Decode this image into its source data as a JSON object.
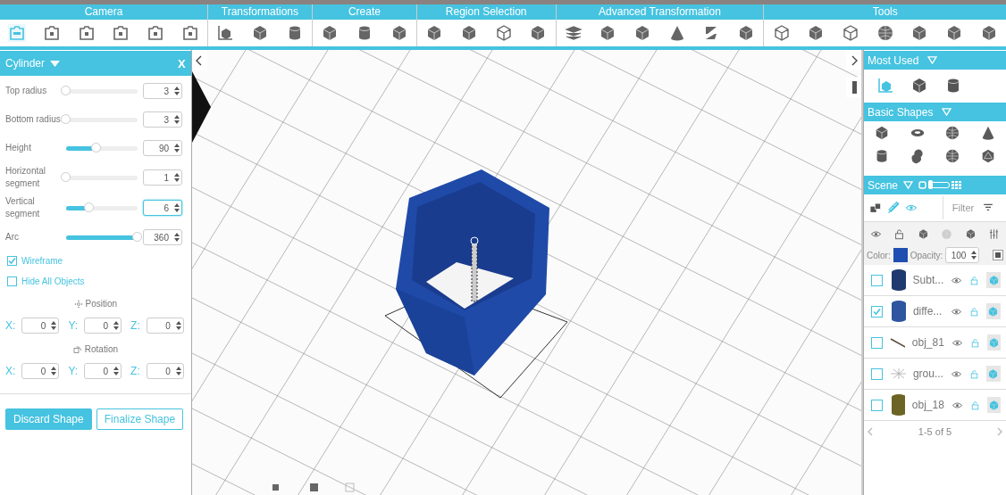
{
  "toolbar": [
    {
      "label": "Camera",
      "tools": [
        {
          "kind": "camera360",
          "selected": true
        },
        {
          "kind": "camera",
          "selected": false
        },
        {
          "kind": "camera",
          "selected": false
        },
        {
          "kind": "camera",
          "selected": false
        },
        {
          "kind": "camera",
          "selected": false
        },
        {
          "kind": "camera",
          "selected": false
        }
      ]
    },
    {
      "label": "Transformations",
      "tools": [
        {
          "kind": "axes",
          "selected": false
        },
        {
          "kind": "cube",
          "selected": false
        },
        {
          "kind": "cylinder",
          "selected": false
        }
      ]
    },
    {
      "label": "Create",
      "tools": [
        {
          "kind": "cube",
          "selected": false
        },
        {
          "kind": "cylinder",
          "selected": false
        },
        {
          "kind": "cube",
          "selected": false
        }
      ]
    },
    {
      "label": "Region Selection",
      "tools": [
        {
          "kind": "cube",
          "selected": false
        },
        {
          "kind": "cube",
          "selected": false
        },
        {
          "kind": "wirecube",
          "selected": false
        },
        {
          "kind": "cube",
          "selected": false
        }
      ]
    },
    {
      "label": "Advanced Transformation",
      "tools": [
        {
          "kind": "layers",
          "selected": false
        },
        {
          "kind": "cube",
          "selected": false
        },
        {
          "kind": "cube",
          "selected": false
        },
        {
          "kind": "cone",
          "selected": false
        },
        {
          "kind": "twist",
          "selected": false
        },
        {
          "kind": "cube",
          "selected": false
        }
      ]
    },
    {
      "label": "Tools",
      "tools": [
        {
          "kind": "wirecube",
          "selected": false
        },
        {
          "kind": "cube",
          "selected": false
        },
        {
          "kind": "wirecube",
          "selected": false
        },
        {
          "kind": "sphere",
          "selected": false
        },
        {
          "kind": "cube",
          "selected": false
        },
        {
          "kind": "cube",
          "selected": false
        },
        {
          "kind": "cube",
          "selected": false
        }
      ]
    }
  ],
  "shape_panel": {
    "title": "Cylinder",
    "close": "X",
    "params": [
      {
        "label": "Top radius",
        "level": 0,
        "value": "3",
        "focused": false
      },
      {
        "label": "Bottom radius",
        "level": 0,
        "value": "3",
        "focused": false
      },
      {
        "label": "Height",
        "level": 0.43,
        "value": "90",
        "focused": false
      },
      {
        "label": "Horizontal segment",
        "level": 0,
        "value": "1",
        "focused": false
      },
      {
        "label": "Vertical segment",
        "level": 0.33,
        "value": "6",
        "focused": true
      },
      {
        "label": "Arc",
        "level": 1,
        "value": "360",
        "focused": false
      }
    ],
    "options": [
      {
        "label": "Wireframe",
        "checked": true
      },
      {
        "label": "Hide All Objects",
        "checked": false
      }
    ],
    "transforms": [
      {
        "kind": "position",
        "label": "Position",
        "axes": [
          {
            "label": "X:",
            "value": "0"
          },
          {
            "label": "Y:",
            "value": "0"
          },
          {
            "label": "Z:",
            "value": "0"
          }
        ]
      },
      {
        "kind": "rotation",
        "label": "Rotation",
        "axes": [
          {
            "label": "X:",
            "value": "0"
          },
          {
            "label": "Y:",
            "value": "0"
          },
          {
            "label": "Z:",
            "value": "0"
          }
        ]
      }
    ],
    "buttons": [
      {
        "label": "Discard Shape",
        "kind": "primary"
      },
      {
        "label": "Finalize Shape",
        "kind": "outline"
      }
    ]
  },
  "most_used": {
    "title": "Most Used",
    "tools": [
      {
        "kind": "axes",
        "selected": true
      },
      {
        "kind": "cube",
        "selected": false
      },
      {
        "kind": "cylinder",
        "selected": false
      }
    ]
  },
  "basic_shapes": {
    "title": "Basic Shapes",
    "shapes": [
      {
        "kind": "cube"
      },
      {
        "kind": "torus"
      },
      {
        "kind": "sphere"
      },
      {
        "kind": "cone"
      },
      {
        "kind": "cylinder"
      },
      {
        "kind": "knot"
      },
      {
        "kind": "sphere"
      },
      {
        "kind": "icosahedron"
      }
    ]
  },
  "scene": {
    "title": "Scene",
    "grid_view": false,
    "filter": {
      "placeholder": "Filter"
    },
    "color_label": "Color:",
    "color": "#1f4fb0",
    "opacity_label": "Opacity:",
    "opacity": "100",
    "objects": [
      {
        "name": "Subt...",
        "checked": false,
        "kind": "cylinder",
        "color": "#1e3a6e"
      },
      {
        "name": "diffe...",
        "checked": true,
        "kind": "cylinder",
        "color": "#2f55a0"
      },
      {
        "name": "obj_81",
        "checked": false,
        "kind": "line"
      },
      {
        "name": "grou...",
        "checked": false,
        "kind": "burst"
      },
      {
        "name": "obj_18",
        "checked": false,
        "kind": "cylinder",
        "color": "#6b6424"
      }
    ],
    "pagination": "1-5 of 5"
  }
}
